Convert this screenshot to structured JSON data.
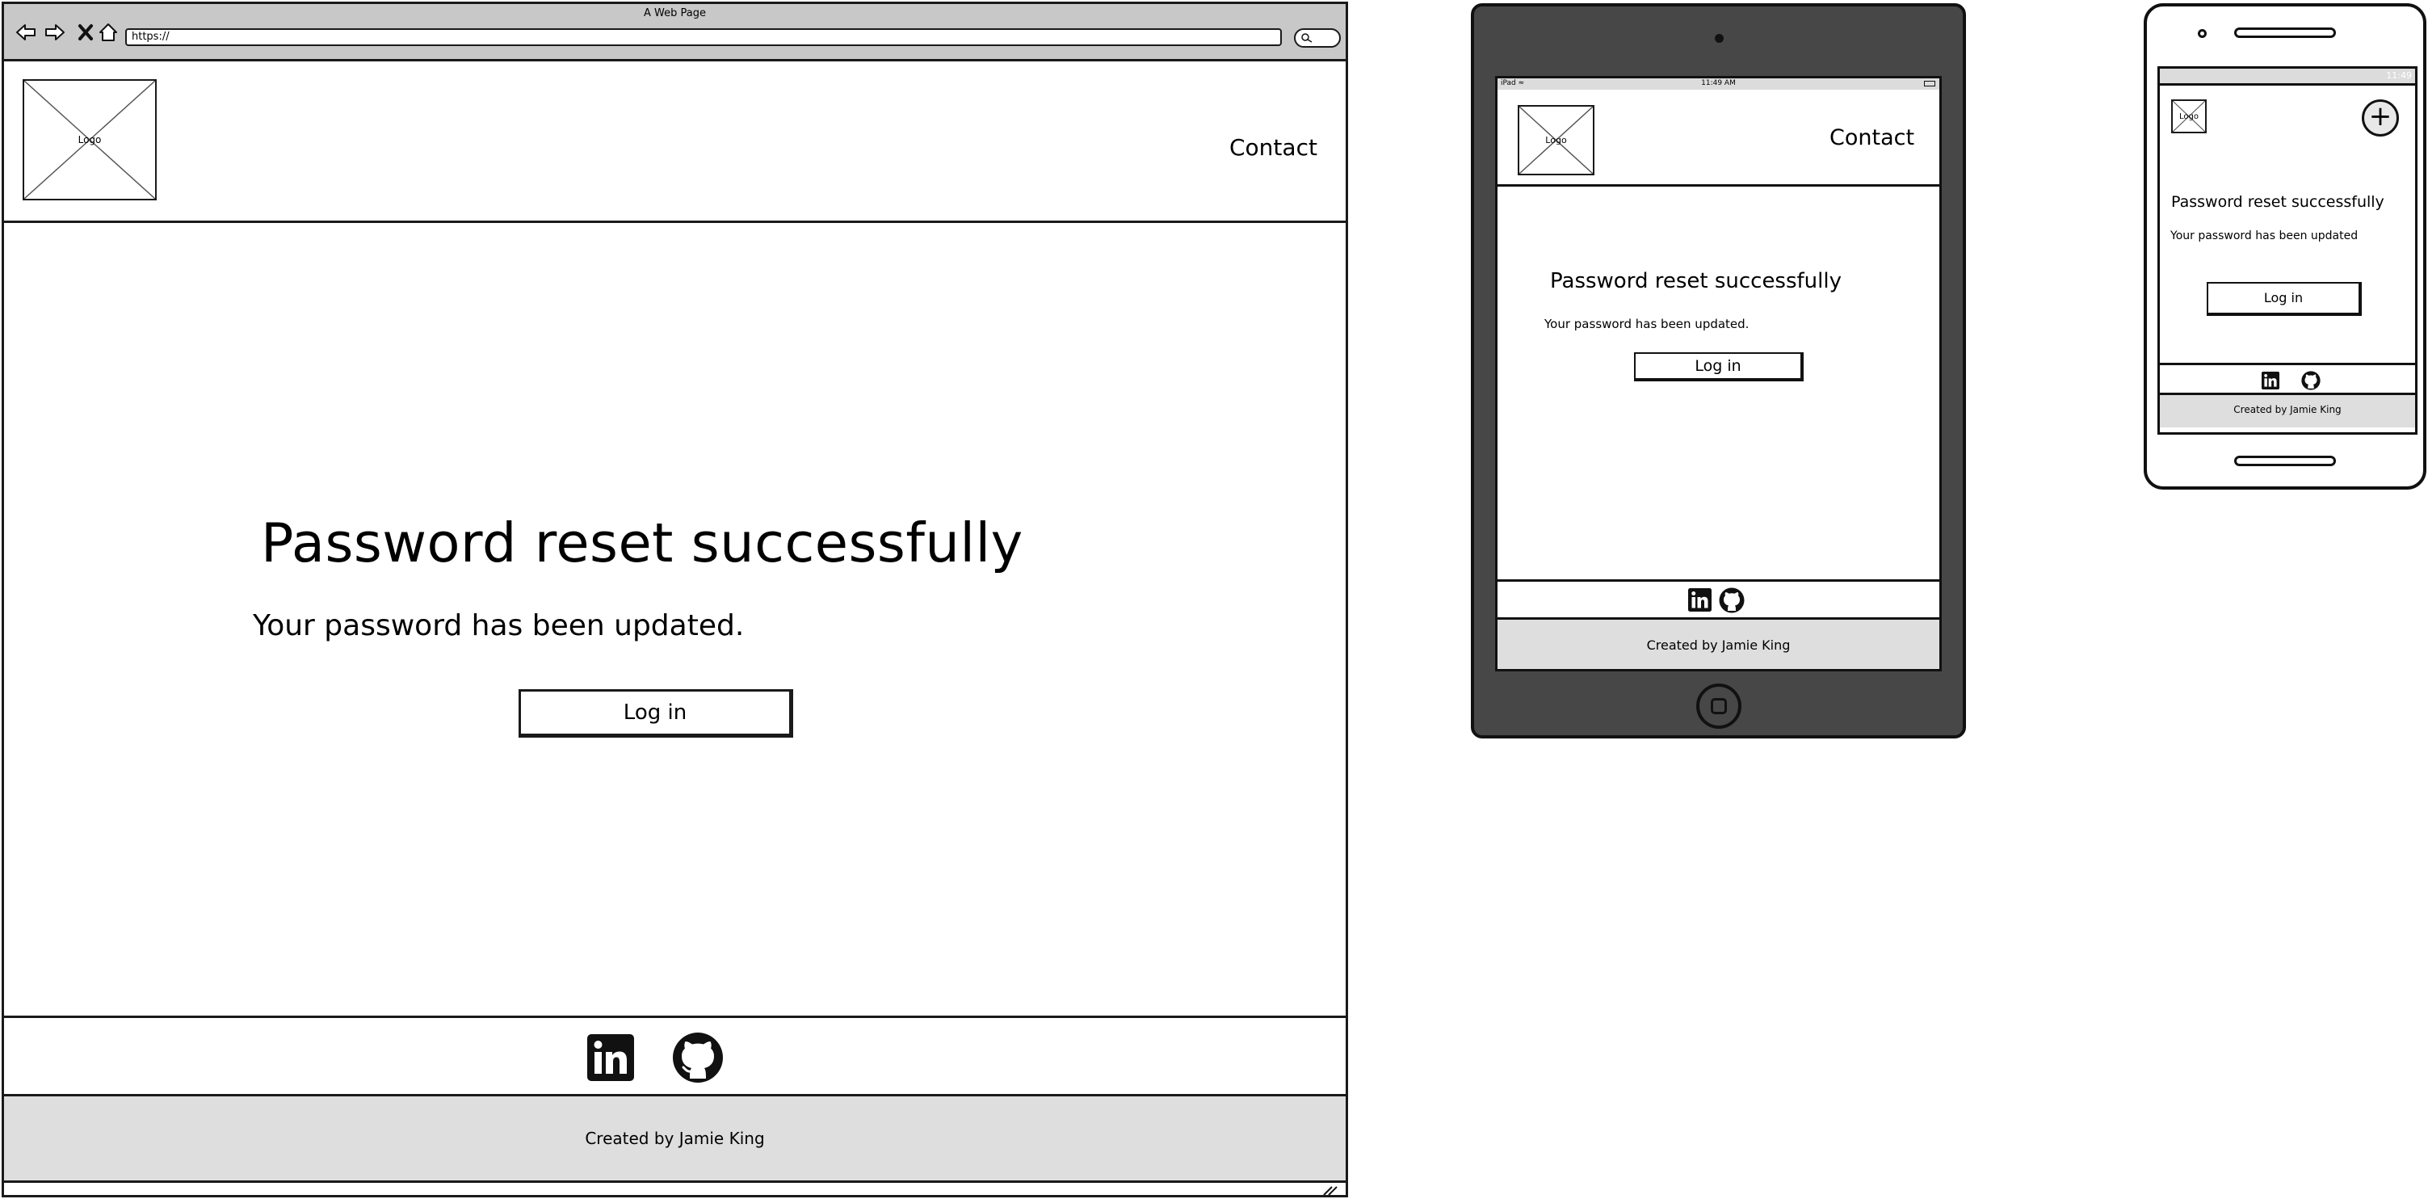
{
  "desktop": {
    "browser_title": "A Web Page",
    "url": "https://",
    "logo_text": "Logo",
    "nav_contact": "Contact",
    "heading": "Password reset successfully",
    "subtext": "Your password has been updated.",
    "login_label": "Log in",
    "footer_text": "Created by Jamie King"
  },
  "tablet": {
    "status_left": "iPad",
    "status_time": "11:49 AM",
    "logo_text": "Logo",
    "nav_contact": "Contact",
    "heading": "Password reset successfully",
    "subtext": "Your password has been updated.",
    "login_label": "Log in",
    "footer_text": "Created by Jamie King"
  },
  "phone": {
    "status_time": "11:49",
    "logo_text": "Logo",
    "menu_symbol": "+",
    "heading": "Password reset successfully",
    "subtext": "Your password has been updated",
    "login_label": "Log in",
    "footer_text": "Created by Jamie King"
  },
  "icons": {
    "back": "arrow-left-icon",
    "forward": "arrow-right-icon",
    "stop": "close-icon",
    "home": "home-icon",
    "social_1": "linkedin-icon",
    "social_2": "github-icon"
  }
}
